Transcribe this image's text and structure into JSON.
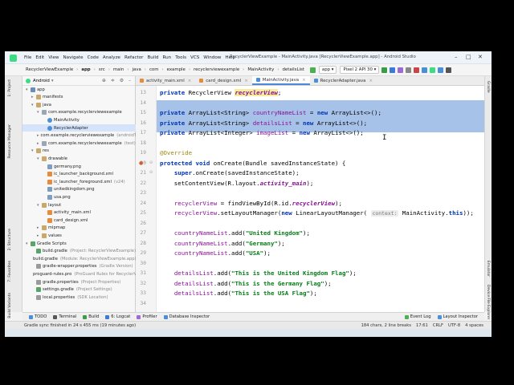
{
  "window": {
    "title": "RecyclerViewExample - MainActivity.java [RecyclerViewExample.app] - Android Studio",
    "menu": [
      "File",
      "Edit",
      "View",
      "Navigate",
      "Code",
      "Analyze",
      "Refactor",
      "Build",
      "Run",
      "Tools",
      "VCS",
      "Window",
      "Help"
    ]
  },
  "toolbar": {
    "breadcrumbs": [
      "RecyclerViewExample",
      "app",
      "src",
      "main",
      "java",
      "com",
      "example",
      "recyclerviewexample",
      "MainActivity",
      "detailsList"
    ],
    "run_config": "app",
    "device": "Pixel 2 API 30"
  },
  "project": {
    "view_mode": "Android",
    "tree": [
      {
        "label": "app",
        "indent": 0,
        "icon": "mod",
        "arrow": "▾"
      },
      {
        "label": "manifests",
        "indent": 1,
        "icon": "folder",
        "arrow": "▸"
      },
      {
        "label": "java",
        "indent": 1,
        "icon": "folder",
        "arrow": "▾"
      },
      {
        "label": "com.example.recyclerviewexample",
        "indent": 2,
        "icon": "pkg",
        "arrow": "▾"
      },
      {
        "label": "MainActivity",
        "indent": 3,
        "icon": "cls",
        "arrow": ""
      },
      {
        "label": "RecyclerAdapter",
        "indent": 3,
        "icon": "cls",
        "arrow": "",
        "selected": true
      },
      {
        "label": "com.example.recyclerviewexample",
        "sub": "(androidTest)",
        "indent": 2,
        "icon": "pkg",
        "arrow": "▸"
      },
      {
        "label": "com.example.recyclerviewexample",
        "sub": "(test)",
        "indent": 2,
        "icon": "pkg",
        "arrow": "▸"
      },
      {
        "label": "res",
        "indent": 1,
        "icon": "folder",
        "arrow": "▾"
      },
      {
        "label": "drawable",
        "indent": 2,
        "icon": "folder",
        "arrow": "▾"
      },
      {
        "label": "germany.png",
        "indent": 3,
        "icon": "png",
        "arrow": ""
      },
      {
        "label": "ic_launcher_background.xml",
        "indent": 3,
        "icon": "xml",
        "arrow": ""
      },
      {
        "label": "ic_launcher_foreground.xml",
        "sub": "(v24)",
        "indent": 3,
        "icon": "xml",
        "arrow": ""
      },
      {
        "label": "unitedkingdom.png",
        "indent": 3,
        "icon": "png",
        "arrow": ""
      },
      {
        "label": "usa.png",
        "indent": 3,
        "icon": "png",
        "arrow": ""
      },
      {
        "label": "layout",
        "indent": 2,
        "icon": "folder",
        "arrow": "▾"
      },
      {
        "label": "activity_main.xml",
        "indent": 3,
        "icon": "xml",
        "arrow": ""
      },
      {
        "label": "card_design.xml",
        "indent": 3,
        "icon": "xml",
        "arrow": ""
      },
      {
        "label": "mipmap",
        "indent": 2,
        "icon": "folder",
        "arrow": "▸"
      },
      {
        "label": "values",
        "indent": 2,
        "icon": "folder",
        "arrow": "▸"
      },
      {
        "label": "Gradle Scripts",
        "indent": 0,
        "icon": "grad",
        "arrow": "▾"
      },
      {
        "label": "build.gradle",
        "sub": "(Project: RecyclerViewExample)",
        "indent": 1,
        "icon": "grad",
        "arrow": ""
      },
      {
        "label": "build.gradle",
        "sub": "(Module: RecyclerViewExample.app)",
        "indent": 1,
        "icon": "grad",
        "arrow": ""
      },
      {
        "label": "gradle-wrapper.properties",
        "sub": "(Gradle Version)",
        "indent": 1,
        "icon": "prop",
        "arrow": ""
      },
      {
        "label": "proguard-rules.pro",
        "sub": "(ProGuard Rules for RecyclerV",
        "indent": 1,
        "icon": "prop",
        "arrow": ""
      },
      {
        "label": "gradle.properties",
        "sub": "(Project Properties)",
        "indent": 1,
        "icon": "prop",
        "arrow": ""
      },
      {
        "label": "settings.gradle",
        "sub": "(Project Settings)",
        "indent": 1,
        "icon": "grad",
        "arrow": ""
      },
      {
        "label": "local.properties",
        "sub": "(SDK Location)",
        "indent": 1,
        "icon": "prop",
        "arrow": ""
      }
    ]
  },
  "left_tool_tabs": [
    "1: Project",
    "Resource Manager",
    "2: Structure",
    "7: Favorites",
    "Build Variants"
  ],
  "right_tool_tabs": [
    "Gradle",
    "Emulator",
    "Device File Explorer"
  ],
  "editor": {
    "tabs": [
      {
        "label": "activity_main.xml",
        "color": "#e48c3a",
        "active": false
      },
      {
        "label": "card_design.xml",
        "color": "#e48c3a",
        "active": false
      },
      {
        "label": "MainActivity.java",
        "color": "#4a90d9",
        "active": true
      },
      {
        "label": "RecyclerAdapter.java",
        "color": "#4a90d9",
        "active": false
      }
    ],
    "line_numbers": [
      "13",
      "14",
      "15",
      "16",
      "17",
      "18",
      "19",
      "20",
      "21",
      "22",
      "23",
      "24",
      "25",
      "26",
      "27",
      "28",
      "29",
      "30",
      "31",
      "32",
      "33",
      "34"
    ],
    "lines": [
      [
        [
          "kw",
          "private "
        ],
        [
          "",
          "RecyclerView "
        ],
        [
          "fld hl",
          "recyclerView"
        ],
        [
          "",
          ";"
        ]
      ],
      [],
      [
        [
          "kw",
          "private "
        ],
        [
          "",
          "ArrayList<String> "
        ],
        [
          "fldn",
          "countryNameList"
        ],
        [
          "",
          " = "
        ],
        [
          "kw",
          "new "
        ],
        [
          "",
          "ArrayList<>();"
        ]
      ],
      [
        [
          "kw",
          "private "
        ],
        [
          "",
          "ArrayList<String> "
        ],
        [
          "fldn",
          "detailsList"
        ],
        [
          "",
          " = "
        ],
        [
          "kw",
          "new "
        ],
        [
          "",
          "ArrayList<>();"
        ]
      ],
      [
        [
          "kw",
          "private "
        ],
        [
          "",
          "ArrayList<Integer> "
        ],
        [
          "fldn",
          "imageList"
        ],
        [
          "",
          " = "
        ],
        [
          "kw",
          "new "
        ],
        [
          "",
          "ArrayList<>();"
        ]
      ],
      [],
      [
        [
          "ann",
          "@Override"
        ]
      ],
      [
        [
          "kw",
          "protected void "
        ],
        [
          "",
          "onCreate(Bundle savedInstanceState) {"
        ]
      ],
      [
        [
          "",
          "    "
        ],
        [
          "kw",
          "super"
        ],
        [
          "",
          ".onCreate(savedInstanceState);"
        ]
      ],
      [
        [
          "",
          "    setContentView(R.layout."
        ],
        [
          "fld",
          "activity_main"
        ],
        [
          "",
          ");"
        ]
      ],
      [],
      [
        [
          "",
          "    "
        ],
        [
          "fldn",
          "recyclerView"
        ],
        [
          "",
          " = findViewById(R.id."
        ],
        [
          "fld",
          "recyclerView"
        ],
        [
          "",
          ");"
        ]
      ],
      [
        [
          "",
          "    "
        ],
        [
          "fldn",
          "recyclerView"
        ],
        [
          "",
          ".setLayoutManager("
        ],
        [
          "kw",
          "new "
        ],
        [
          "",
          "LinearLayoutManager( "
        ],
        [
          "hint",
          "context:"
        ],
        [
          "",
          " MainActivity."
        ],
        [
          "kw",
          "this"
        ],
        [
          "",
          "));"
        ]
      ],
      [],
      [
        [
          "",
          "    "
        ],
        [
          "fldn",
          "countryNameList"
        ],
        [
          "",
          ".add("
        ],
        [
          "str",
          "\"United Kingdom\""
        ],
        [
          "",
          ");"
        ]
      ],
      [
        [
          "",
          "    "
        ],
        [
          "fldn",
          "countryNameList"
        ],
        [
          "",
          ".add("
        ],
        [
          "str",
          "\"Germany\""
        ],
        [
          "",
          ");"
        ]
      ],
      [
        [
          "",
          "    "
        ],
        [
          "fldn",
          "countryNameList"
        ],
        [
          "",
          ".add("
        ],
        [
          "str",
          "\"USA\""
        ],
        [
          "",
          ");"
        ]
      ],
      [],
      [
        [
          "",
          "    "
        ],
        [
          "fldn",
          "detailsList"
        ],
        [
          "",
          ".add("
        ],
        [
          "str",
          "\"This is the United Kingdom Flag\""
        ],
        [
          "",
          ");"
        ]
      ],
      [
        [
          "",
          "    "
        ],
        [
          "fldn",
          "detailsList"
        ],
        [
          "",
          ".add("
        ],
        [
          "str",
          "\"This is the Germany Flag\""
        ],
        [
          "",
          ");"
        ]
      ],
      [
        [
          "",
          "    "
        ],
        [
          "fldn",
          "detailsList"
        ],
        [
          "",
          ".add("
        ],
        [
          "str",
          "\"This is the USA Flag\""
        ],
        [
          "",
          ");"
        ]
      ],
      []
    ]
  },
  "bottom_tabs": [
    "TODO",
    "Terminal",
    "Build",
    "6: Logcat",
    "Profiler",
    "Database Inspector"
  ],
  "bottom_right_tabs": [
    "Event Log",
    "Layout Inspector"
  ],
  "status": {
    "message": "Gradle sync finished in 24 s 455 ms (19 minutes ago)",
    "selection": "184 chars, 2 line breaks",
    "position": "17:61",
    "line_sep": "CRLF",
    "encoding": "UTF-8",
    "indent": "4 spaces"
  }
}
